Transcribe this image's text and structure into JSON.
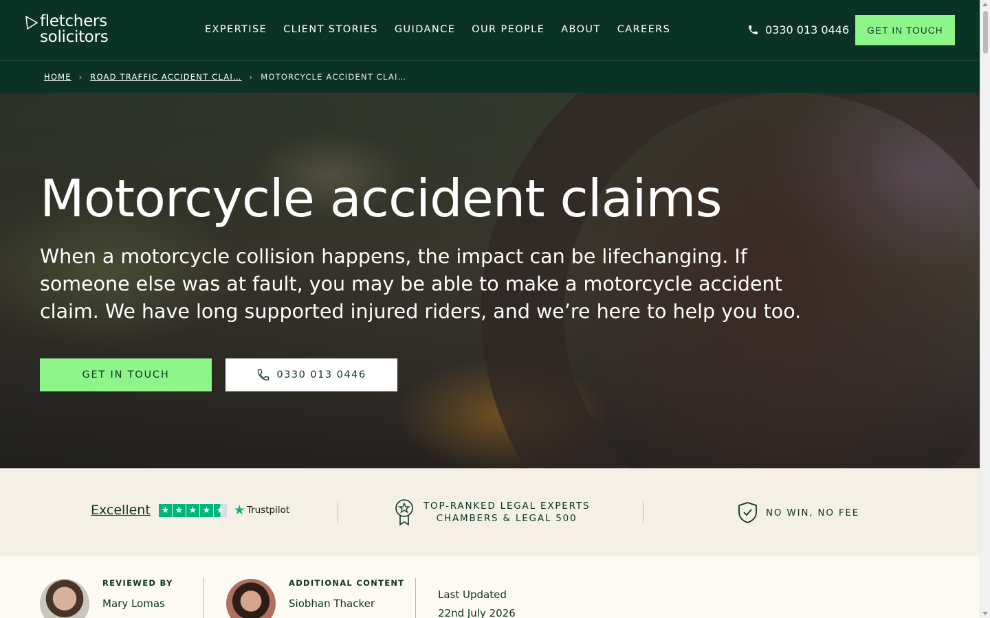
{
  "header": {
    "logo_line1": "fletchers",
    "logo_line2": "solicitors",
    "nav": [
      "EXPERTISE",
      "CLIENT STORIES",
      "GUIDANCE",
      "OUR PEOPLE",
      "ABOUT",
      "CAREERS"
    ],
    "phone": "0330 013 0446",
    "cta_label": "GET IN TOUCH"
  },
  "breadcrumb": {
    "home": "HOME",
    "parent": "ROAD TRAFFIC ACCIDENT CLAI…",
    "current": "MOTORCYCLE ACCIDENT CLAI…"
  },
  "hero": {
    "title": "Motorcycle accident claims",
    "intro": "When a motorcycle collision happens, the impact can be lifechanging. If someone else was at fault, you may be able to make a motorcycle accident claim. We have long supported injured riders, and we’re here to help you too.",
    "primary_button": "GET IN TOUCH",
    "phone_button": "0330 013 0446"
  },
  "trust": {
    "rating_word": "Excellent",
    "trustpilot_brand": "Trustpilot",
    "rating_stars": 4.5,
    "award_line1": "TOP-RANKED LEGAL EXPERTS",
    "award_line2": "CHAMBERS & LEGAL 500",
    "no_win_no_fee": "NO WIN, NO FEE"
  },
  "reviewers": {
    "reviewed_by_label": "REVIEWED BY",
    "reviewed_by_name": "Mary Lomas",
    "additional_label": "ADDITIONAL CONTENT",
    "additional_name": "Siobhan Thacker",
    "updated_label": "Last Updated",
    "updated_date": "22nd July 2026"
  },
  "colors": {
    "brand_dark_green": "#0b3325",
    "accent_green": "#8ef58a",
    "trust_strip_bg": "#f4f0e6",
    "trustpilot_green": "#00b67a"
  }
}
